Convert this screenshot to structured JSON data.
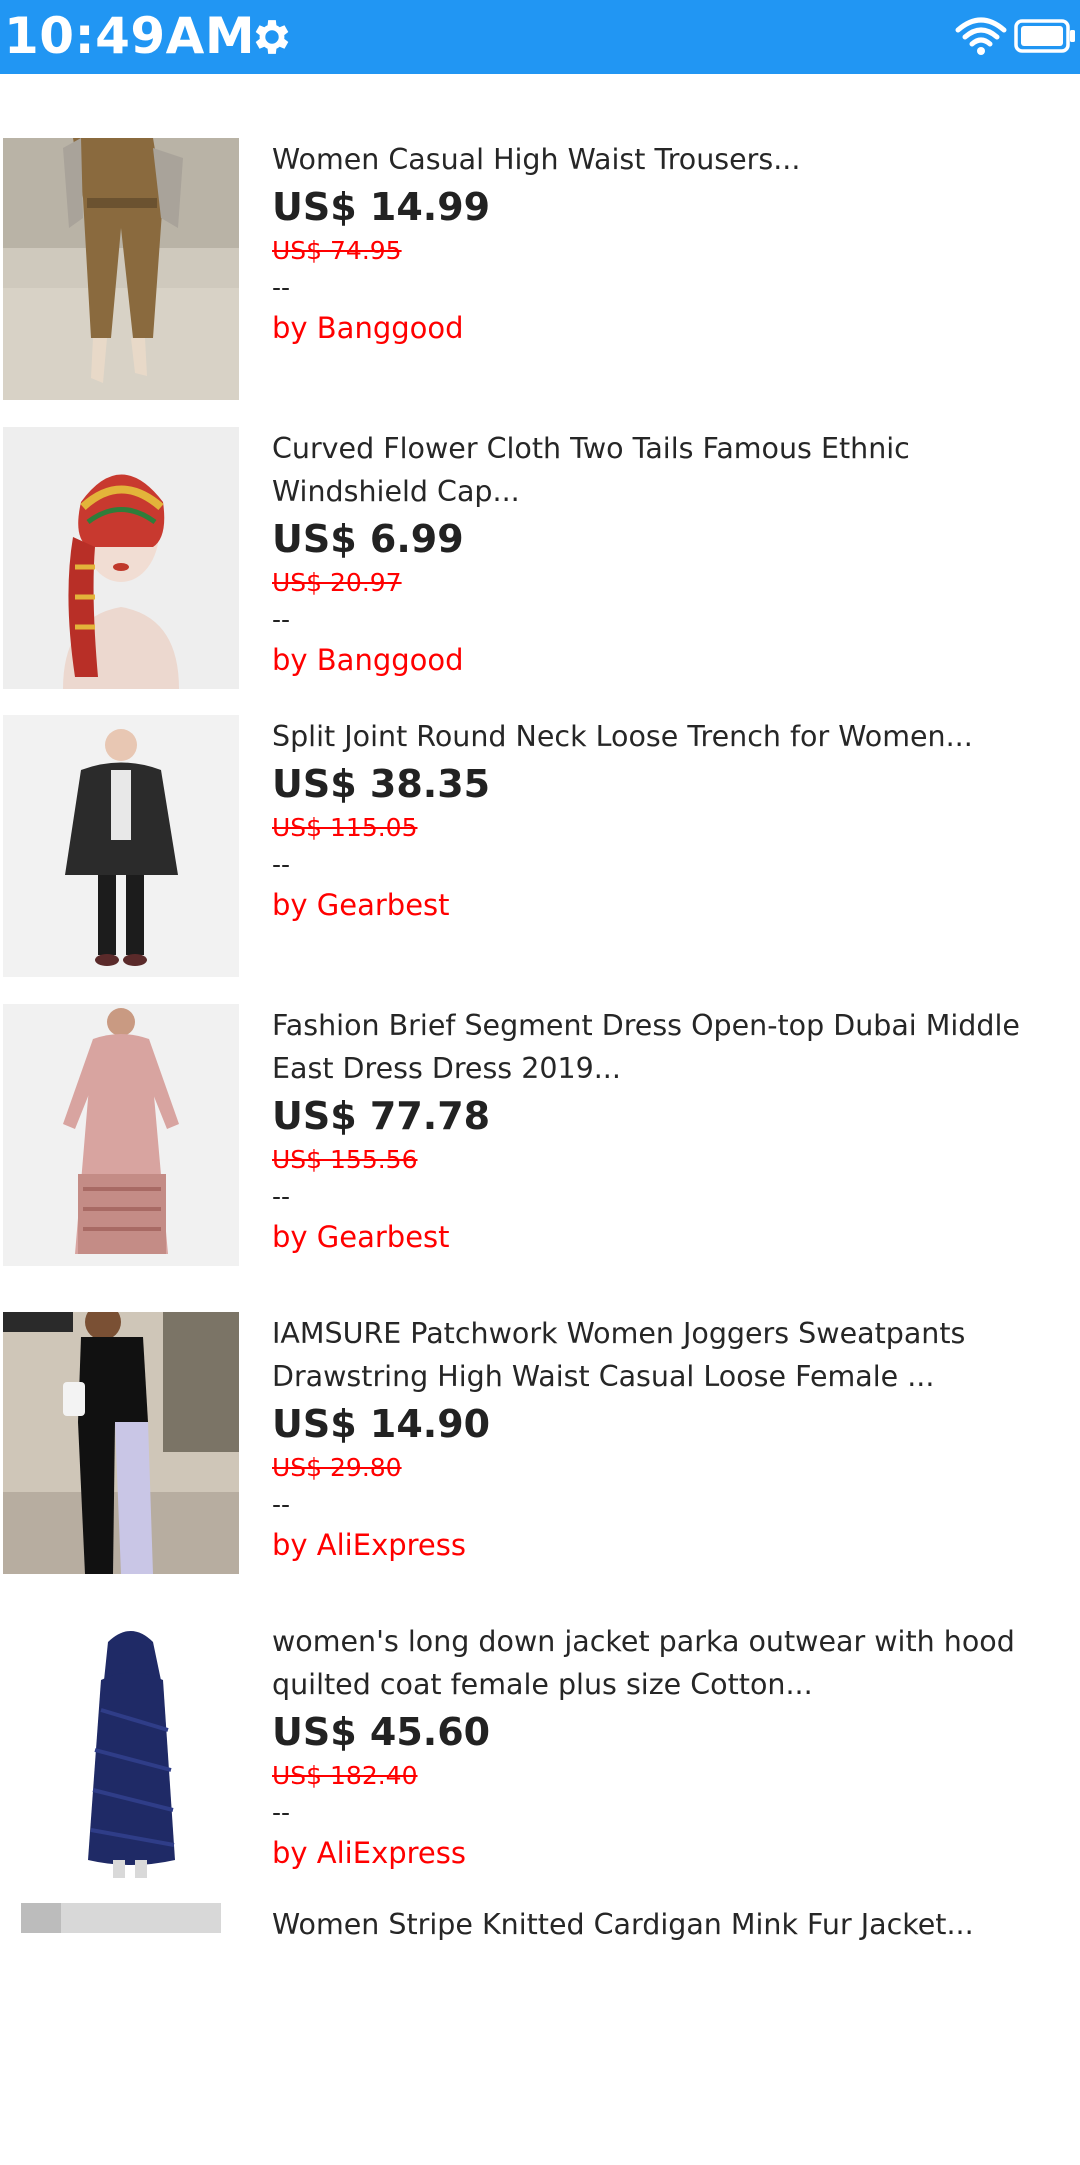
{
  "status_bar": {
    "time": "10:49AM",
    "settings_icon": "gear-icon",
    "wifi_icon": "wifi-icon",
    "battery_icon": "battery-icon",
    "background_color": "#2196F3"
  },
  "products": [
    {
      "title": "Women Casual High Waist Trousers...",
      "price": "US$ 14.99",
      "old_price": "US$ 74.95",
      "rating": "--",
      "vendor": "by Banggood"
    },
    {
      "title": "Curved Flower Cloth Two Tails Famous Ethnic Windshield Cap...",
      "price": "US$ 6.99",
      "old_price": "US$ 20.97",
      "rating": "--",
      "vendor": "by Banggood"
    },
    {
      "title": "Split Joint Round Neck Loose Trench for Women...",
      "price": "US$ 38.35",
      "old_price": "US$ 115.05",
      "rating": "--",
      "vendor": "by Gearbest"
    },
    {
      "title": "Fashion Brief Segment Dress Open-top Dubai Middle East Dress Dress 2019...",
      "price": "US$ 77.78",
      "old_price": "US$ 155.56",
      "rating": "--",
      "vendor": "by Gearbest"
    },
    {
      "title": "IAMSURE Patchwork Women Joggers Sweatpants Drawstring High Waist Casual Loose Female ...",
      "price": "US$ 14.90",
      "old_price": "US$ 29.80",
      "rating": "--",
      "vendor": "by AliExpress"
    },
    {
      "title": "women's long down jacket parka outwear with hood quilted coat female plus size Cotton...",
      "price": "US$ 45.60",
      "old_price": "US$ 182.40",
      "rating": "--",
      "vendor": "by AliExpress"
    },
    {
      "title": "Women Stripe Knitted Cardigan Mink Fur Jacket..."
    }
  ]
}
